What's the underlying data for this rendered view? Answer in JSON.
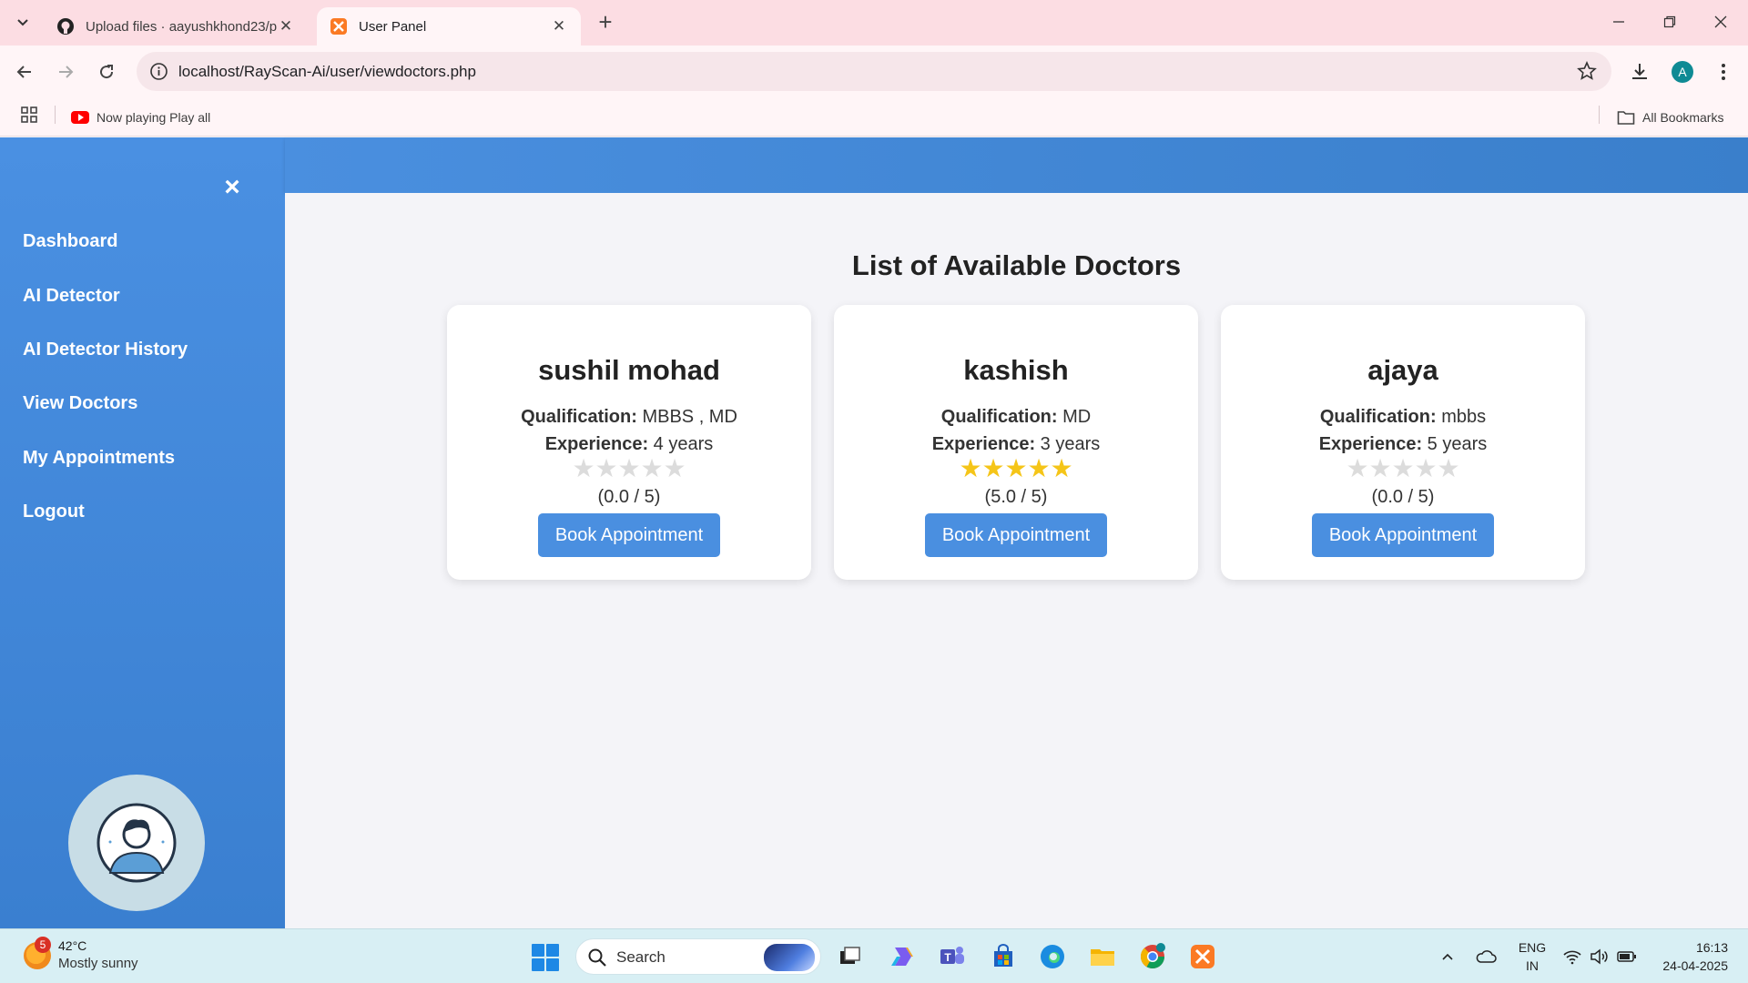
{
  "browser": {
    "tabs": [
      {
        "title": "Upload files · aayushkhond23/p",
        "active": false
      },
      {
        "title": "User Panel",
        "active": true
      }
    ],
    "url": "localhost/RayScan-Ai/user/viewdoctors.php",
    "bookmark_item": "Now playing Play all",
    "all_bookmarks": "All Bookmarks",
    "profile_initial": "A"
  },
  "sidebar": {
    "close_glyph": "×",
    "items": [
      {
        "label": "Dashboard"
      },
      {
        "label": "AI Detector"
      },
      {
        "label": "AI Detector History"
      },
      {
        "label": "View Doctors"
      },
      {
        "label": "My Appointments"
      },
      {
        "label": "Logout"
      }
    ]
  },
  "page": {
    "title": "List of Available Doctors",
    "qualification_label": "Qualification:",
    "experience_label": "Experience:",
    "book_label": "Book Appointment",
    "doctors": [
      {
        "name": "sushil mohad",
        "qualification": "MBBS , MD",
        "experience": "4 years",
        "rating": 0.0,
        "rating_text": "(0.0 / 5)"
      },
      {
        "name": "kashish",
        "qualification": "MD",
        "experience": "3 years",
        "rating": 5.0,
        "rating_text": "(5.0 / 5)"
      },
      {
        "name": "ajaya",
        "qualification": "mbbs",
        "experience": "5 years",
        "rating": 0.0,
        "rating_text": "(0.0 / 5)"
      }
    ]
  },
  "colors": {
    "sidebar": "#4a90e2",
    "button": "#4a8fe0",
    "star_on": "#f5c518",
    "star_off": "#dcdcdc"
  },
  "taskbar": {
    "weather_temp": "42°C",
    "weather_desc": "Mostly sunny",
    "weather_badge": "5",
    "search_label": "Search",
    "lang_line1": "ENG",
    "lang_line2": "IN",
    "time": "16:13",
    "date": "24-04-2025"
  }
}
